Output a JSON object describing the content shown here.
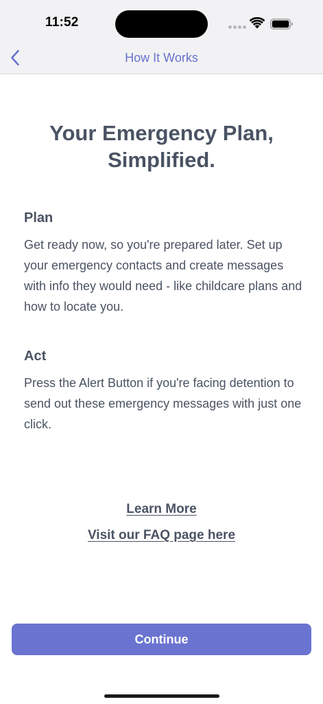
{
  "status_bar": {
    "time": "11:52",
    "icons": [
      "signal-dots-icon",
      "wifi-icon",
      "battery-icon"
    ]
  },
  "nav": {
    "title": "How It Works",
    "back_icon": "chevron-left-icon",
    "accent_color": "#6872cf"
  },
  "main": {
    "title": "Your Emergency Plan, Simplified.",
    "sections": [
      {
        "heading": "Plan",
        "body": "Get ready now, so you're prepared later. Set up your emergency contacts and create messages with info they would need - like childcare plans and how to locate you."
      },
      {
        "heading": "Act",
        "body": "Press the Alert Button if you're facing detention to send out these emergency messages with just one click."
      }
    ],
    "links": {
      "learn_more": "Learn More",
      "faq": "Visit our FAQ page here"
    }
  },
  "footer": {
    "continue_label": "Continue",
    "button_color": "#6a74d0"
  }
}
